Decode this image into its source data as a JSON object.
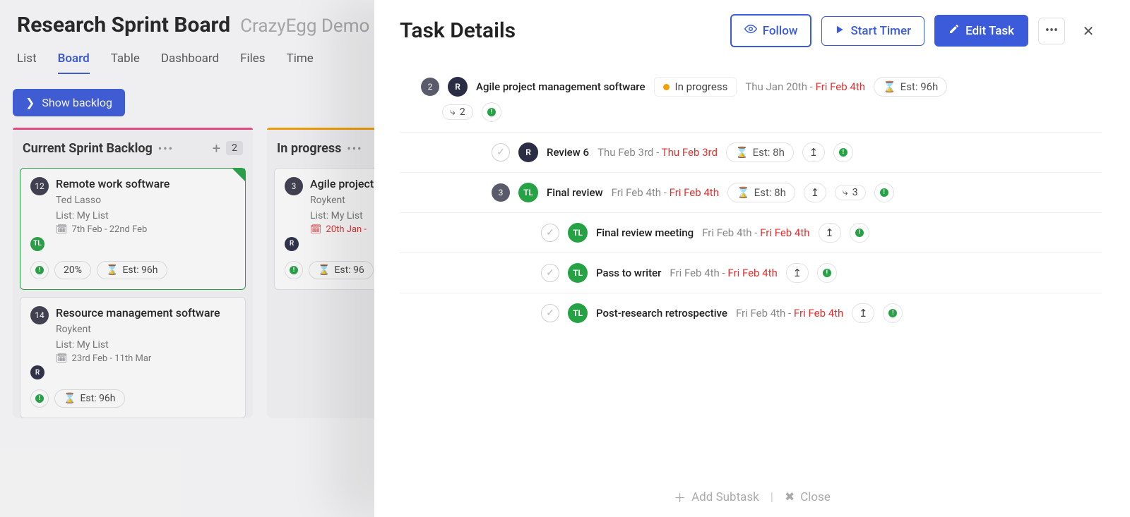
{
  "board": {
    "title": "Research Sprint Board",
    "subtitle": "CrazyEgg Demo",
    "view_tabs": [
      "List",
      "Board",
      "Table",
      "Dashboard",
      "Files",
      "Time"
    ],
    "active_tab_index": 1,
    "backlog_button": "Show backlog",
    "columns": [
      {
        "title": "Current Sprint Backlog",
        "accent": "#e64980",
        "count": "2",
        "cards": [
          {
            "num": "12",
            "title": "Remote work software",
            "assignee": "Ted Lasso",
            "list_line": "List: My List",
            "dates": "7th Feb - 22nd Feb",
            "avatar": {
              "cls": "tl",
              "text": "TL"
            },
            "progress": "20%",
            "est": "Est: 96h",
            "active": true
          },
          {
            "num": "14",
            "title": "Resource management software",
            "assignee": "Roykent",
            "list_line": "List: My List",
            "dates": "23rd Feb - 11th Mar",
            "avatar": {
              "cls": "r",
              "text": "R"
            },
            "est": "Est: 96h"
          }
        ]
      },
      {
        "title": "In progress",
        "accent": "#f59f00",
        "cards": [
          {
            "num": "3",
            "title": "Agile project software",
            "assignee": "Roykent",
            "list_line": "List: My List",
            "dates": "20th Jan -",
            "dates_red": true,
            "avatar": {
              "cls": "r",
              "text": "R"
            },
            "est": "Est: 96"
          }
        ]
      }
    ]
  },
  "panel": {
    "title": "Task Details",
    "follow": "Follow",
    "start_timer": "Start Timer",
    "edit_task": "Edit Task",
    "footer": {
      "add_subtask": "Add Subtask",
      "close": "Close"
    },
    "rows": [
      {
        "level": 0,
        "num": "2",
        "avatar": {
          "cls": "r",
          "text": "R"
        },
        "title": "Agile project management software",
        "status": "In progress",
        "date_a": "Thu Jan 20th - ",
        "date_b": "Fri Feb 4th",
        "est": "Est: 96h",
        "subtasks": "2",
        "show_priority_after": true
      },
      {
        "level": 1,
        "check": true,
        "avatar": {
          "cls": "r",
          "text": "R"
        },
        "title": "Review 6",
        "date_a": "Thu Feb 3rd - ",
        "date_b": "Thu Feb 3rd",
        "est": "Est: 8h",
        "arrow": true,
        "priority": true
      },
      {
        "level": 1,
        "num": "3",
        "avatar": {
          "cls": "tl",
          "text": "TL"
        },
        "title": "Final review",
        "date_a": "Fri Feb 4th - ",
        "date_b": "Fri Feb 4th",
        "est": "Est: 8h",
        "arrow": true,
        "subtasks": "3",
        "priority": true
      },
      {
        "level": 2,
        "check": true,
        "avatar": {
          "cls": "tl",
          "text": "TL"
        },
        "title": "Final review meeting",
        "date_a": "Fri Feb 4th - ",
        "date_b": "Fri Feb 4th",
        "arrow": true,
        "priority": true
      },
      {
        "level": 2,
        "check": true,
        "avatar": {
          "cls": "tl",
          "text": "TL"
        },
        "title": "Pass to writer",
        "date_a": "Fri Feb 4th - ",
        "date_b": "Fri Feb 4th",
        "arrow": true,
        "priority": true
      },
      {
        "level": 2,
        "check": true,
        "avatar": {
          "cls": "tl",
          "text": "TL"
        },
        "title": "Post-research retrospective",
        "date_a": "Fri Feb 4th - ",
        "date_b": "Fri Feb 4th",
        "arrow": true,
        "priority": true
      }
    ]
  }
}
